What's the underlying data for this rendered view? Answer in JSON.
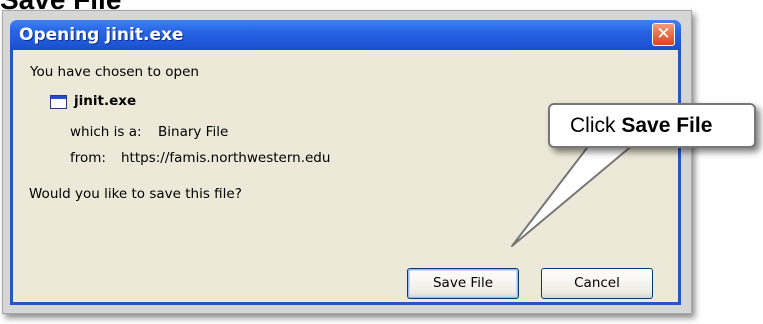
{
  "page_heading": "Save File",
  "dialog": {
    "title": "Opening jinit.exe",
    "close_symbol": "✕",
    "intro": "You have chosen to open",
    "file_name": "jinit.exe",
    "file_icon": "application-window-icon",
    "which_is_label": "which is a:",
    "file_type": "Binary File",
    "from_label": "from:",
    "source_url": "https://famis.northwestern.edu",
    "question": "Would you like to save this file?",
    "save_button": "Save File",
    "cancel_button": "Cancel"
  },
  "callout": {
    "prefix": "Click ",
    "bold": "Save File"
  },
  "colors": {
    "titlebar": "#2966e6",
    "dialog_body": "#ece9d8",
    "close_button": "#d7461e"
  }
}
